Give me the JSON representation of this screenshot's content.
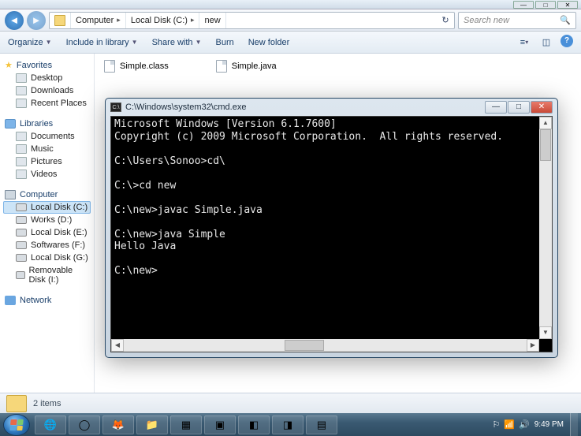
{
  "chrome": {
    "min": "—",
    "max": "□",
    "close": "✕"
  },
  "nav": {
    "segments": [
      "Computer",
      "Local Disk (C:)",
      "new"
    ],
    "search_placeholder": "Search new"
  },
  "toolbar": {
    "organize": "Organize",
    "include": "Include in library",
    "share": "Share with",
    "burn": "Burn",
    "newfolder": "New folder"
  },
  "sidebar": {
    "favorites": {
      "header": "Favorites",
      "items": [
        "Desktop",
        "Downloads",
        "Recent Places"
      ]
    },
    "libraries": {
      "header": "Libraries",
      "items": [
        "Documents",
        "Music",
        "Pictures",
        "Videos"
      ]
    },
    "computer": {
      "header": "Computer",
      "items": [
        "Local Disk (C:)",
        "Works (D:)",
        "Local Disk (E:)",
        "Softwares (F:)",
        "Local Disk (G:)",
        "Removable Disk (I:)"
      ]
    },
    "network": {
      "header": "Network"
    }
  },
  "files": [
    {
      "name": "Simple.class"
    },
    {
      "name": "Simple.java"
    }
  ],
  "cmd": {
    "title": "C:\\Windows\\system32\\cmd.exe",
    "body": "Microsoft Windows [Version 6.1.7600]\nCopyright (c) 2009 Microsoft Corporation.  All rights reserved.\n\nC:\\Users\\Sonoo>cd\\\n\nC:\\>cd new\n\nC:\\new>javac Simple.java\n\nC:\\new>java Simple\nHello Java\n\nC:\\new>"
  },
  "status": {
    "text": "2 items"
  },
  "tray": {
    "time": "9:49 PM",
    "date": ""
  }
}
